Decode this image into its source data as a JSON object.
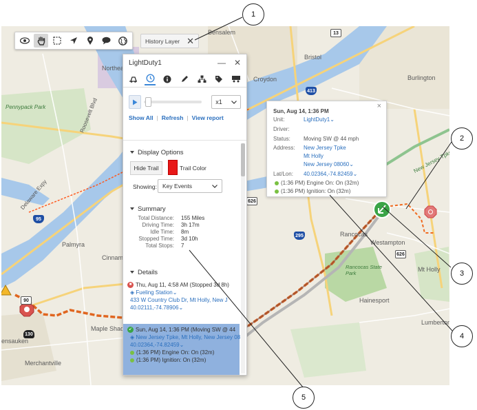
{
  "toolbar": {
    "tools": [
      "eye-icon",
      "pan-hand-icon",
      "select-box-icon",
      "locate-arrow-icon",
      "pin-icon",
      "chat-icon",
      "globe-icon"
    ],
    "history_layer_label": "History Layer",
    "history_close": "✕"
  },
  "map": {
    "labels": {
      "northeast_airport": "Northeast Philadelphia Airport",
      "pennypack": "Pennypack Park",
      "bensalem": "Bensalem",
      "bristol": "Bristol",
      "croydon": "Croydon",
      "burlington": "Burlington",
      "palmyra": "Palmyra",
      "cinnaminson": "Cinnam",
      "rancocas": "Rancocas",
      "westampton": "Westampton",
      "mt_holly": "Mt Holly",
      "rancocas_park": "Rancocas State Park",
      "hainesport": "Hainesport",
      "lumberton": "Lumberton",
      "pennsauken": "ensauken",
      "maple_shade": "Maple Shade",
      "merchantville": "Merchantville",
      "nj_tpke": "New Jersey Tpke",
      "delaware": "Delaware Expy",
      "roosevelt": "Roosevelt Blvd"
    },
    "shields": {
      "r13": "13",
      "r413": "413",
      "r95": "95",
      "r626a": "626",
      "r626b": "626",
      "r295": "295",
      "r130": "130",
      "r90": "90"
    }
  },
  "panel": {
    "title": "LightDuty1",
    "minimize": "—",
    "close": "✕",
    "tabs": [
      "truck-icon",
      "history-clock-icon",
      "info-icon",
      "pencil-icon",
      "hierarchy-icon",
      "tag-icon",
      "trailer-icon"
    ],
    "speed": "x1",
    "links": {
      "show_all": "Show All",
      "refresh": "Refresh",
      "view_report": "View report"
    },
    "display_options": {
      "heading": "Display Options",
      "hide_trail": "Hide Trail",
      "trail_color_label": "Trail Color",
      "trail_color": "#e81818",
      "showing_label": "Showing:",
      "showing_value": "Key Events"
    },
    "summary": {
      "heading": "Summary",
      "rows": [
        {
          "k": "Total Distance:",
          "v": "155 Miles"
        },
        {
          "k": "Driving Time:",
          "v": "3h 17m"
        },
        {
          "k": "Idle Time:",
          "v": "8m"
        },
        {
          "k": "Stopped Time:",
          "v": "3d 10h"
        },
        {
          "k": "Total Stops:",
          "v": "7"
        }
      ]
    },
    "details": {
      "heading": "Details",
      "event1": {
        "title": "Thu, Aug 11, 4:58 AM (Stopped 3d 8h)",
        "place": "Fueling Station",
        "address": "433 W Country Club Dr, Mt Holly, New J",
        "coords": "40.02111,-74.78906"
      },
      "event2": {
        "title": "Sun, Aug 14, 1:36 PM (Moving SW @ 44",
        "address": "New Jersey Tpke, Mt Holly, New Jersey 08",
        "coords": "40.02364,-74.82459",
        "sub1": "(1:36 PM) Engine On: On (32m)",
        "sub2": "(1:36 PM) Ignition: On (32m)"
      }
    }
  },
  "popup": {
    "title": "Sun, Aug 14, 1:36 PM",
    "close": "×",
    "unit_k": "Unit:",
    "unit_v": "LightDuty1",
    "driver_k": "Driver:",
    "status_k": "Status:",
    "status_v": "Moving SW @ 44 mph",
    "address_k": "Address:",
    "address_1": "New Jersey Tpke",
    "address_2": "Mt Holly",
    "address_3": "New Jersey 08060",
    "latlon_k": "Lat/Lon:",
    "latlon_v": "40.02364,-74.82459",
    "ev1": "(1:36 PM) Engine On: On (32m)",
    "ev2": "(1:36 PM) Ignition: On (32m)"
  },
  "callouts": [
    "1",
    "2",
    "3",
    "4",
    "5"
  ],
  "colors": {
    "trail": "#e0651f",
    "accent": "#2a6fbe",
    "vehicle": "#3aa447",
    "stop": "#d9534f"
  }
}
